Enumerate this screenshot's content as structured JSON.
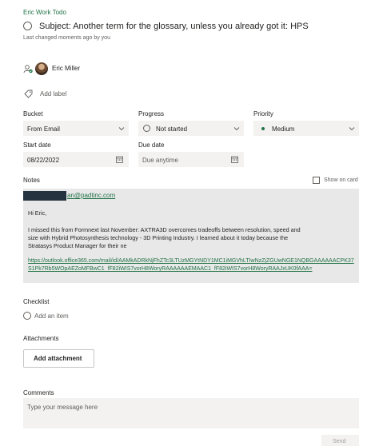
{
  "plan_name": "Eric Work Todo",
  "task_title": "Subject: Another term for the glossary, unless you already got it: HPS",
  "last_changed": "Last changed moments ago by you",
  "assignee": {
    "name": "Eric Miller"
  },
  "add_label": "Add label",
  "bucket": {
    "label": "Bucket",
    "value": "From Email"
  },
  "progress": {
    "label": "Progress",
    "value": "Not started"
  },
  "priority": {
    "label": "Priority",
    "value": "Medium",
    "color": "#217346"
  },
  "start_date": {
    "label": "Start date",
    "value": "08/22/2022"
  },
  "due_date": {
    "label": "Due date",
    "placeholder": "Due anytime"
  },
  "notes": {
    "label": "Notes",
    "show_on_card": "Show on card",
    "email_link": "an@padtinc.com",
    "greeting": "Hi Eric,",
    "line1": "I missed this from Formnext last November: AXTRA3D overcomes tradeoffs between resolution, speed and",
    "line2": "size with Hybrid Photosynthesis technology - 3D Printing Industry. I learned about it today because the",
    "line3": "Stratasys Product Manager for their ne",
    "url": "https://outlook.office365.com/mail/id/AAMkADRkNjFhZTc3LTUzMGYtNDY1MC1iMGVhLTIwNzZjZGUwNGE1NQBGAAAAAACPK37S1Pk7Rb5WOpAEZoMFBwC1_fF82iWIS7vorH8WoryRAAAAAAEMAAC1_fF82iWIS7vorH8WoryRAAJxUK0fAAA="
  },
  "checklist": {
    "label": "Checklist",
    "add_item": "Add an item"
  },
  "attachments": {
    "label": "Attachments",
    "button": "Add attachment"
  },
  "comments": {
    "label": "Comments",
    "placeholder": "Type your message here",
    "send": "Send"
  }
}
